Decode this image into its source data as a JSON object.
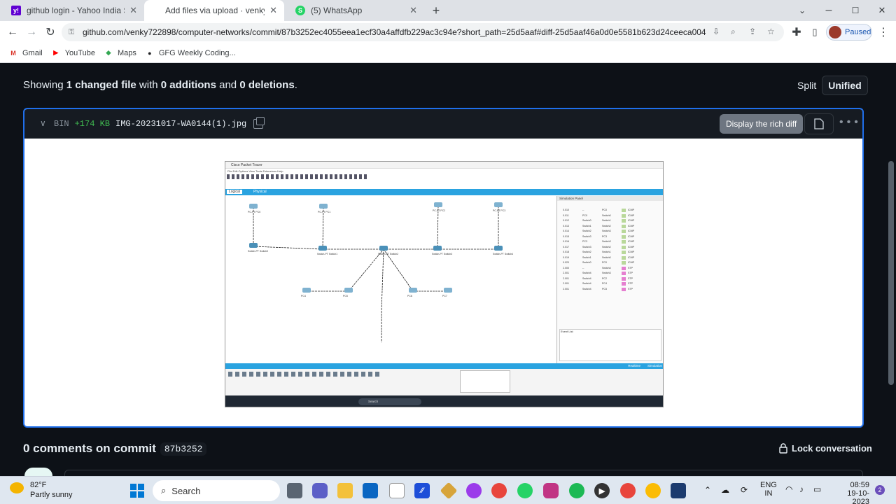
{
  "tabs": [
    {
      "title": "github login - Yahoo India Searc",
      "icon": "y!"
    },
    {
      "title": "Add files via upload · venky7228",
      "icon": ""
    },
    {
      "title": "(5) WhatsApp",
      "icon": "S"
    }
  ],
  "address": {
    "url": "github.com/venky722898/computer-networks/commit/87b3252ec4055eea1ecf30a4affdfb229ac3c94e?short_path=25d5aaf#diff-25d5aaf46a0d0e5581b623d24ceeca0044f6..."
  },
  "profile": {
    "status": "Paused"
  },
  "bookmarks": [
    {
      "label": "Gmail",
      "icon": "M",
      "color": "#d93025"
    },
    {
      "label": "YouTube",
      "icon": "▶",
      "color": "#ff0000"
    },
    {
      "label": "Maps",
      "icon": "◆",
      "color": "#34a853"
    },
    {
      "label": "GFG Weekly Coding...",
      "icon": "●",
      "color": "#202124"
    }
  ],
  "summary": {
    "prefix": "Showing ",
    "files": "1 changed file",
    "mid1": " with ",
    "additions": "0 additions",
    "mid2": " and ",
    "deletions": "0 deletions",
    "suffix": "."
  },
  "view": {
    "split": "Split",
    "unified": "Unified"
  },
  "file": {
    "bin": "BIN",
    "size": "+174 KB",
    "name": "IMG-20231017-WA0144(1).jpg",
    "tooltip": "Display the rich diff"
  },
  "embedded": {
    "window_title": "Cisco Packet Tracer",
    "menu": "File  Edit  Options  View  Tools  Extensions  Help",
    "logical": "Logical",
    "physical": "Physical",
    "sim_panel": "Simulation Panel",
    "event_list": "Event List",
    "nodes": [
      {
        "label": "PC-PT PC0"
      },
      {
        "label": "PC-PT PC1"
      },
      {
        "label": "PC-PT PC2"
      },
      {
        "label": "PC-PT PC3"
      },
      {
        "label": "Switch-PT Switch0"
      },
      {
        "label": "Switch-PT Switch1"
      },
      {
        "label": "Switch-PT Switch2"
      },
      {
        "label": "Switch-PT Switch3"
      },
      {
        "label": "Switch-PT Switch4"
      },
      {
        "label": "PC4"
      },
      {
        "label": "PC5"
      },
      {
        "label": "PC6"
      },
      {
        "label": "PC7"
      }
    ],
    "events": [
      {
        "time": "0.010",
        "last": "--",
        "at": "PC0",
        "type": "ICMP"
      },
      {
        "time": "0.011",
        "last": "PC0",
        "at": "Switch0",
        "type": "ICMP"
      },
      {
        "time": "0.012",
        "last": "Switch0",
        "at": "Switch1",
        "type": "ICMP"
      },
      {
        "time": "0.013",
        "last": "Switch1",
        "at": "Switch2",
        "type": "ICMP"
      },
      {
        "time": "0.014",
        "last": "Switch2",
        "at": "Switch3",
        "type": "ICMP"
      },
      {
        "time": "0.015",
        "last": "Switch3",
        "at": "PC3",
        "type": "ICMP"
      },
      {
        "time": "0.016",
        "last": "PC3",
        "at": "Switch3",
        "type": "ICMP"
      },
      {
        "time": "0.017",
        "last": "Switch3",
        "at": "Switch2",
        "type": "ICMP"
      },
      {
        "time": "0.018",
        "last": "Switch2",
        "at": "Switch1",
        "type": "ICMP"
      },
      {
        "time": "0.019",
        "last": "Switch1",
        "at": "Switch0",
        "type": "ICMP"
      },
      {
        "time": "0.020",
        "last": "Switch0",
        "at": "PC0",
        "type": "ICMP"
      },
      {
        "time": "2.000",
        "last": "--",
        "at": "Switch4",
        "type": "STP"
      },
      {
        "time": "2.001",
        "last": "Switch4",
        "at": "Switch3",
        "type": "STP"
      },
      {
        "time": "2.001",
        "last": "Switch4",
        "at": "PC2",
        "type": "STP"
      },
      {
        "time": "2.001",
        "last": "Switch4",
        "at": "PC4",
        "type": "STP"
      },
      {
        "time": "2.001",
        "last": "Switch4",
        "at": "PC5",
        "type": "STP"
      }
    ],
    "realtime": "Realtime",
    "simulation": "Simulation",
    "search": "Search"
  },
  "comments": {
    "title": "0 comments on commit",
    "sha": "87b3252"
  },
  "lock": {
    "label": "Lock conversation"
  },
  "taskbar": {
    "temp": "82°F",
    "weather": "Partly sunny",
    "search": "Search",
    "lang1": "ENG",
    "lang2": "IN",
    "time": "08:59",
    "date": "19-10-2023",
    "badge": "2"
  }
}
